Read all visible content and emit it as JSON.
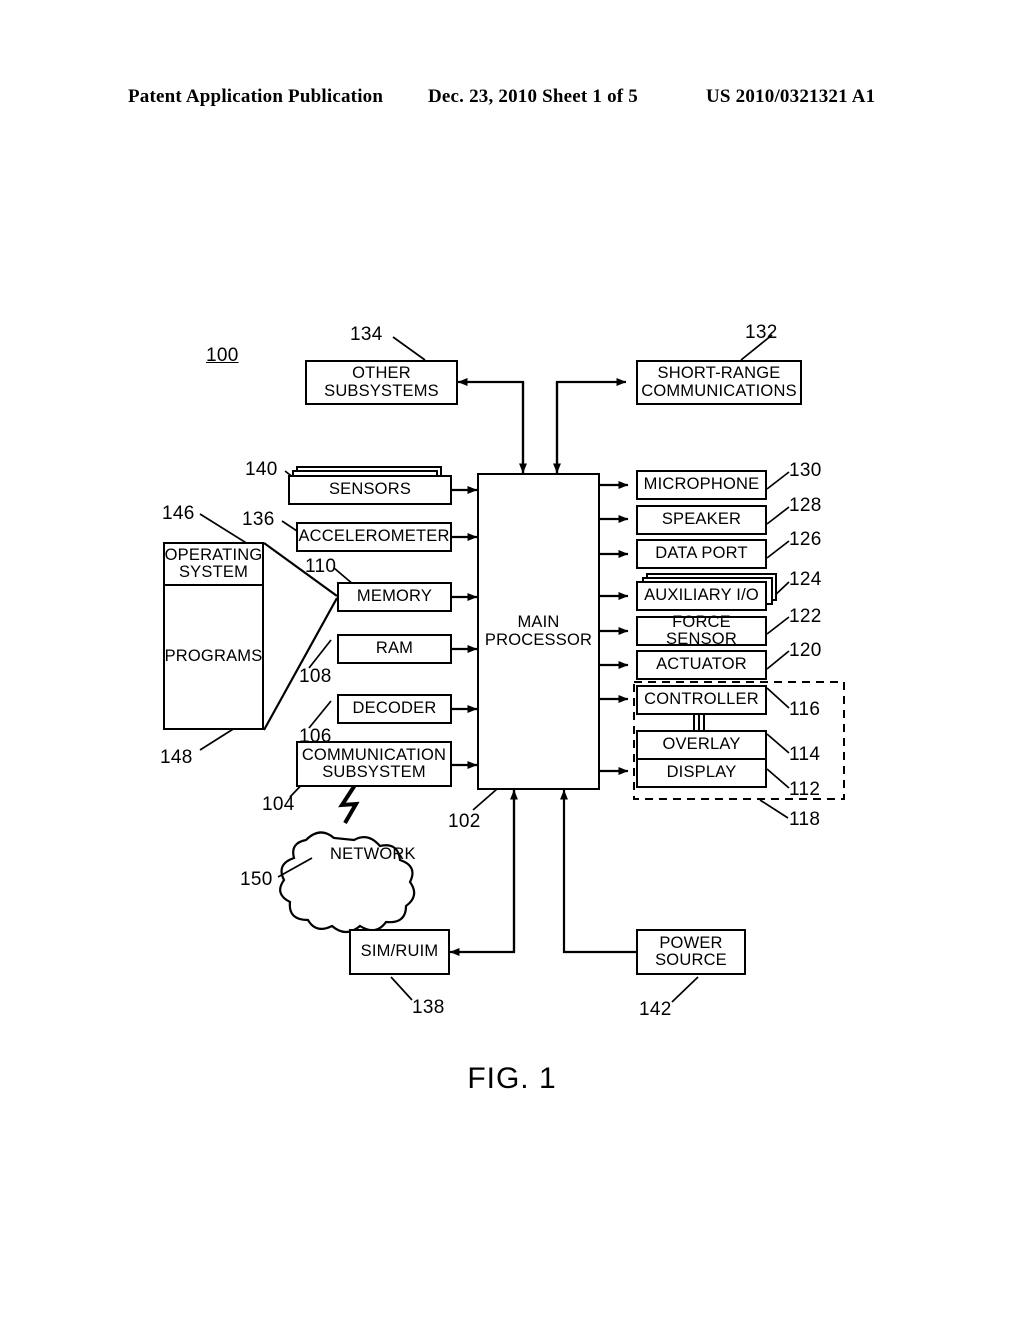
{
  "header": {
    "publication": "Patent Application Publication",
    "date_sheet": "Dec. 23, 2010  Sheet 1 of 5",
    "patent_number": "US 2010/0321321 A1"
  },
  "figure": {
    "label": "FIG. 1",
    "system_ref": "100"
  },
  "blocks": {
    "other_subsystems": {
      "line1": "OTHER",
      "line2": "SUBSYSTEMS",
      "ref": "134"
    },
    "short_range": {
      "line1": "SHORT-RANGE",
      "line2": "COMMUNICATIONS",
      "ref": "132"
    },
    "sensors": {
      "label": "SENSORS",
      "ref": "140"
    },
    "accelerometer": {
      "label": "ACCELEROMETER",
      "ref": "136"
    },
    "memory": {
      "label": "MEMORY",
      "ref": "110"
    },
    "ram": {
      "label": "RAM",
      "ref": "108"
    },
    "decoder": {
      "label": "DECODER",
      "ref": "106"
    },
    "communication_subsystem": {
      "line1": "COMMUNICATION",
      "line2": "SUBSYSTEM",
      "ref": "104"
    },
    "main_processor": {
      "line1": "MAIN",
      "line2": "PROCESSOR",
      "ref": "102"
    },
    "operating_system": {
      "line1": "OPERATING",
      "line2": "SYSTEM",
      "ref": "146"
    },
    "programs": {
      "label": "PROGRAMS",
      "ref": "148"
    },
    "network": {
      "label": "NETWORK",
      "ref": "150"
    },
    "sim_ruim": {
      "label": "SIM/RUIM",
      "ref": "138"
    },
    "power_source": {
      "line1": "POWER",
      "line2": "SOURCE",
      "ref": "142"
    },
    "microphone": {
      "label": "MICROPHONE",
      "ref": "130"
    },
    "speaker": {
      "label": "SPEAKER",
      "ref": "128"
    },
    "data_port": {
      "label": "DATA PORT",
      "ref": "126"
    },
    "auxiliary_io": {
      "label": "AUXILIARY I/O",
      "ref": "124"
    },
    "force_sensor": {
      "label": "FORCE SENSOR",
      "ref": "122"
    },
    "actuator": {
      "label": "ACTUATOR",
      "ref": "120"
    },
    "controller": {
      "label": "CONTROLLER",
      "ref": "116"
    },
    "overlay": {
      "label": "OVERLAY",
      "ref": "114"
    },
    "display": {
      "label": "DISPLAY",
      "ref": "112"
    },
    "touchscreen_group": {
      "ref": "118"
    }
  },
  "colors": {
    "ink": "#000000",
    "paper": "#ffffff"
  }
}
